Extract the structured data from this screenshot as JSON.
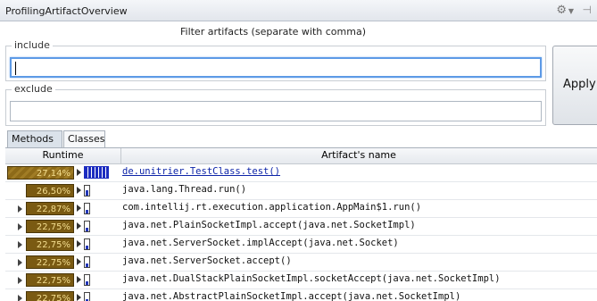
{
  "window": {
    "title": "ProfilingArtifactOverview",
    "gear_icon": "gear-icon",
    "pin_icon": "pin-icon"
  },
  "filter": {
    "heading": "Filter artifacts (separate with comma)",
    "include_label": "include",
    "include_value": "",
    "exclude_label": "exclude",
    "exclude_value": "",
    "apply_label": "Apply"
  },
  "tabs": [
    {
      "label": "Methods",
      "selected": true
    },
    {
      "label": "Classes",
      "selected": false
    }
  ],
  "table": {
    "columns": [
      "Runtime",
      "Artifact's name"
    ],
    "rows": [
      {
        "runtime": "27,14%",
        "name": "de.unitrier.TestClass.test()",
        "selected": true
      },
      {
        "runtime": "26,50%",
        "name": "java.lang.Thread.run()"
      },
      {
        "runtime": "22,87%",
        "name": "com.intellij.rt.execution.application.AppMain$1.run()"
      },
      {
        "runtime": "22,75%",
        "name": "java.net.PlainSocketImpl.accept(java.net.SocketImpl)"
      },
      {
        "runtime": "22,75%",
        "name": "java.net.ServerSocket.implAccept(java.net.Socket)"
      },
      {
        "runtime": "22,75%",
        "name": "java.net.ServerSocket.accept()"
      },
      {
        "runtime": "22,75%",
        "name": "java.net.DualStackPlainSocketImpl.socketAccept(java.net.SocketImpl)"
      },
      {
        "runtime": "22,75%",
        "name": "java.net.AbstractPlainSocketImpl.accept(java.net.SocketImpl)"
      }
    ]
  },
  "colors": {
    "runtime_bar": "#7a5a12",
    "runtime_text": "#f3dd8f",
    "focus_border": "#5d9ae6",
    "link": "#0d24a8"
  }
}
